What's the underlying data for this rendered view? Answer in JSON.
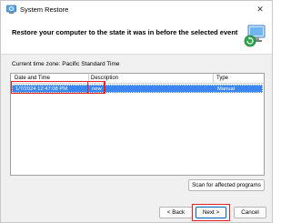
{
  "window": {
    "title": "System Restore",
    "close_glyph": "✕"
  },
  "header": {
    "heading": "Restore your computer to the state it was in before the selected event",
    "icon": "system-restore-computer-icon"
  },
  "timezone": "Current time zone: Pacific Standard Time",
  "table": {
    "columns": [
      "Date and Time",
      "Description",
      "Type"
    ],
    "rows": [
      {
        "date_time": "1/7/2024 12:47:08 PM",
        "description": "new",
        "type": "Manual",
        "selected": true
      }
    ]
  },
  "buttons": {
    "scan": "Scan for affected programs",
    "back": "< Back",
    "next": "Next >",
    "cancel": "Cancel"
  },
  "colors": {
    "selection": "#3b86f0",
    "highlight": "#e8202a",
    "accent": "#0067c0"
  }
}
